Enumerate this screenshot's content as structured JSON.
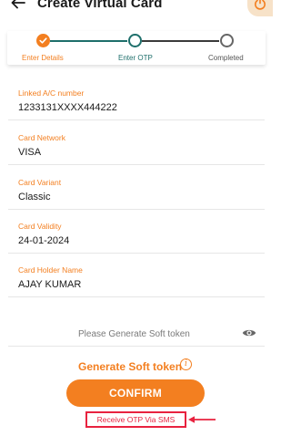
{
  "header": {
    "title": "Create Virtual Card",
    "back_icon": "arrow-left-icon",
    "power_icon": "power-icon"
  },
  "stepper": {
    "steps": [
      {
        "label": "Enter Details",
        "status": "done"
      },
      {
        "label": "Enter OTP",
        "status": "active"
      },
      {
        "label": "Completed",
        "status": "pending"
      }
    ]
  },
  "fields": [
    {
      "label": "Linked A/C number",
      "value": "1233131XXXX444222"
    },
    {
      "label": "Card Network",
      "value": "VISA"
    },
    {
      "label": "Card Variant",
      "value": "Classic"
    },
    {
      "label": "Card Validity",
      "value": "24-01-2024"
    },
    {
      "label": "Card Holder Name",
      "value": "AJAY KUMAR"
    }
  ],
  "soft_token": {
    "placeholder": "Please Generate Soft token",
    "toggle_icon": "eye-icon",
    "generate_label": "Generate Soft token",
    "info_icon": "info-icon",
    "info_glyph": "i"
  },
  "actions": {
    "confirm_label": "CONFIRM",
    "otp_sms_label": "Receive OTP Via SMS"
  },
  "colors": {
    "accent": "#f37f20",
    "step_active": "#1e6f6b",
    "highlight": "#e8223f"
  }
}
